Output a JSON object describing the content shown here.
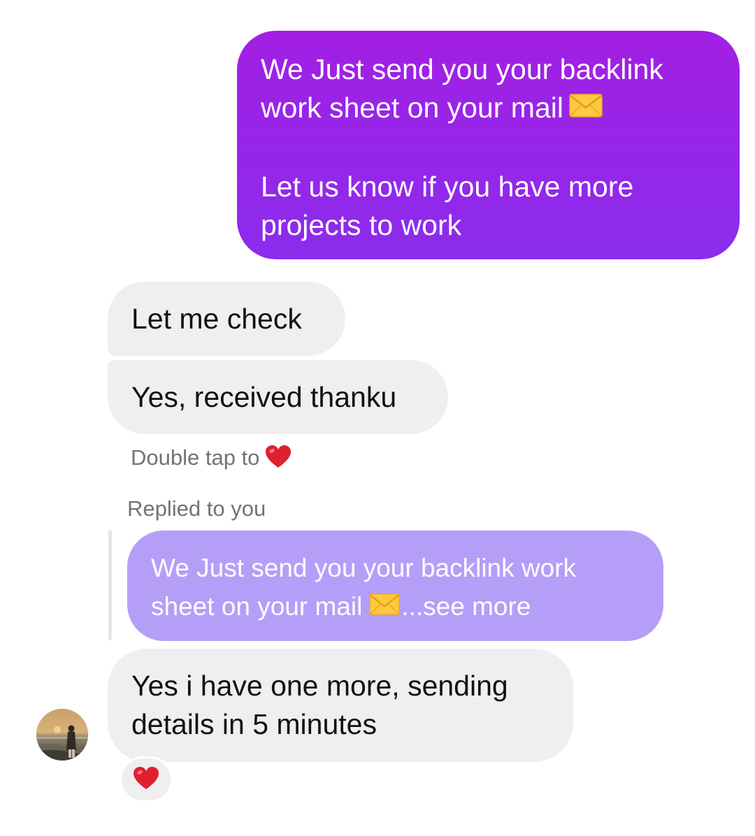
{
  "messages": {
    "outgoing": {
      "line1": "We Just send you your backlink",
      "line2": "work sheet on your mail",
      "line3": "Let us know if you have more",
      "line4": "projects to work",
      "emoji": "envelope-icon"
    },
    "incoming_1": {
      "text": "Let me check"
    },
    "incoming_2": {
      "text": "Yes, received thanku"
    },
    "double_tap": {
      "text": "Double tap to",
      "emoji": "heart-icon"
    },
    "reply": {
      "label": "Replied to you",
      "quoted_line1": "We Just send you your backlink work",
      "quoted_line2": "sheet on your mail",
      "see_more": "...see more"
    },
    "incoming_3": {
      "line1": "Yes i have one more, sending",
      "line2": "details in 5 minutes",
      "reaction": "heart-icon"
    }
  },
  "colors": {
    "outgoing_gradient_top": "#a21fe3",
    "outgoing_gradient_bottom": "#8b2ced",
    "incoming_bubble": "#efefef",
    "quoted_bubble": "#b59ef8",
    "meta_text": "#737373",
    "heart": "#e0202f"
  }
}
